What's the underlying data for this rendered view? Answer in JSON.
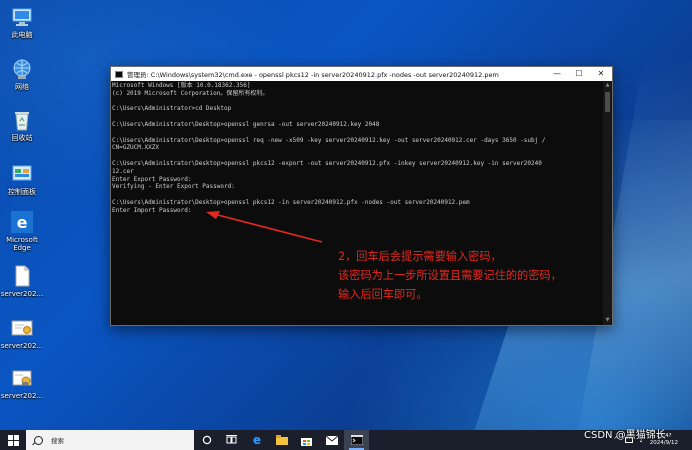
{
  "desktop": {
    "icons": [
      {
        "label": "此电脑",
        "icon": "computer-icon"
      },
      {
        "label": "网络",
        "icon": "network-icon"
      },
      {
        "label": "回收站",
        "icon": "recycle-bin-icon"
      },
      {
        "label": "控制面板",
        "icon": "control-panel-icon"
      },
      {
        "label": "Microsoft",
        "label2": "Edge",
        "icon": "edge-icon"
      },
      {
        "label": "server202...",
        "icon": "file-icon"
      },
      {
        "label": "server202...",
        "icon": "certificate-icon"
      },
      {
        "label": "server202...",
        "icon": "pfx-icon"
      }
    ]
  },
  "window": {
    "title": "管理员: C:\\Windows\\system32\\cmd.exe - openssl  pkcs12 -in server20240912.pfx -nodes -out server20240912.pem",
    "minimize": "—",
    "maximize": "☐",
    "close": "✕",
    "lines": [
      "Microsoft Windows [版本 10.0.18362.356]",
      "(c) 2019 Microsoft Corporation。保留所有权利。",
      "",
      "C:\\Users\\Administrator>cd Desktop",
      "",
      "C:\\Users\\Administrator\\Desktop>openssl genrsa -out server20240912.key 2048",
      "",
      "C:\\Users\\Administrator\\Desktop>openssl req -new -x509 -key server20240912.key -out server20240912.cer -days 3650 -subj /",
      "CN=GZUCM.XXZX",
      "",
      "C:\\Users\\Administrator\\Desktop>openssl pkcs12 -export -out server20240912.pfx -inkey server20240912.key -in server20240",
      "12.cer",
      "Enter Export Password:",
      "Verifying - Enter Export Password:",
      "",
      "C:\\Users\\Administrator\\Desktop>openssl pkcs12 -in server20240912.pfx -nodes -out server20240912.pem",
      "Enter Import Password:"
    ]
  },
  "annotation": {
    "line1": "2，回车后会提示需要输入密码，",
    "line2": "该密码为上一步所设置且需要记住的的密码，",
    "line3": "输入后回车即可。",
    "color": "#e52820"
  },
  "taskbar": {
    "search_placeholder": "搜索",
    "apps": [
      "task-view-icon",
      "edge-icon",
      "file-explorer-icon",
      "store-icon",
      "mail-icon",
      "cmd-icon"
    ],
    "clock_time": "17:4?",
    "clock_date": "2024/9/12"
  },
  "watermark": "CSDN @黑猫锦长"
}
